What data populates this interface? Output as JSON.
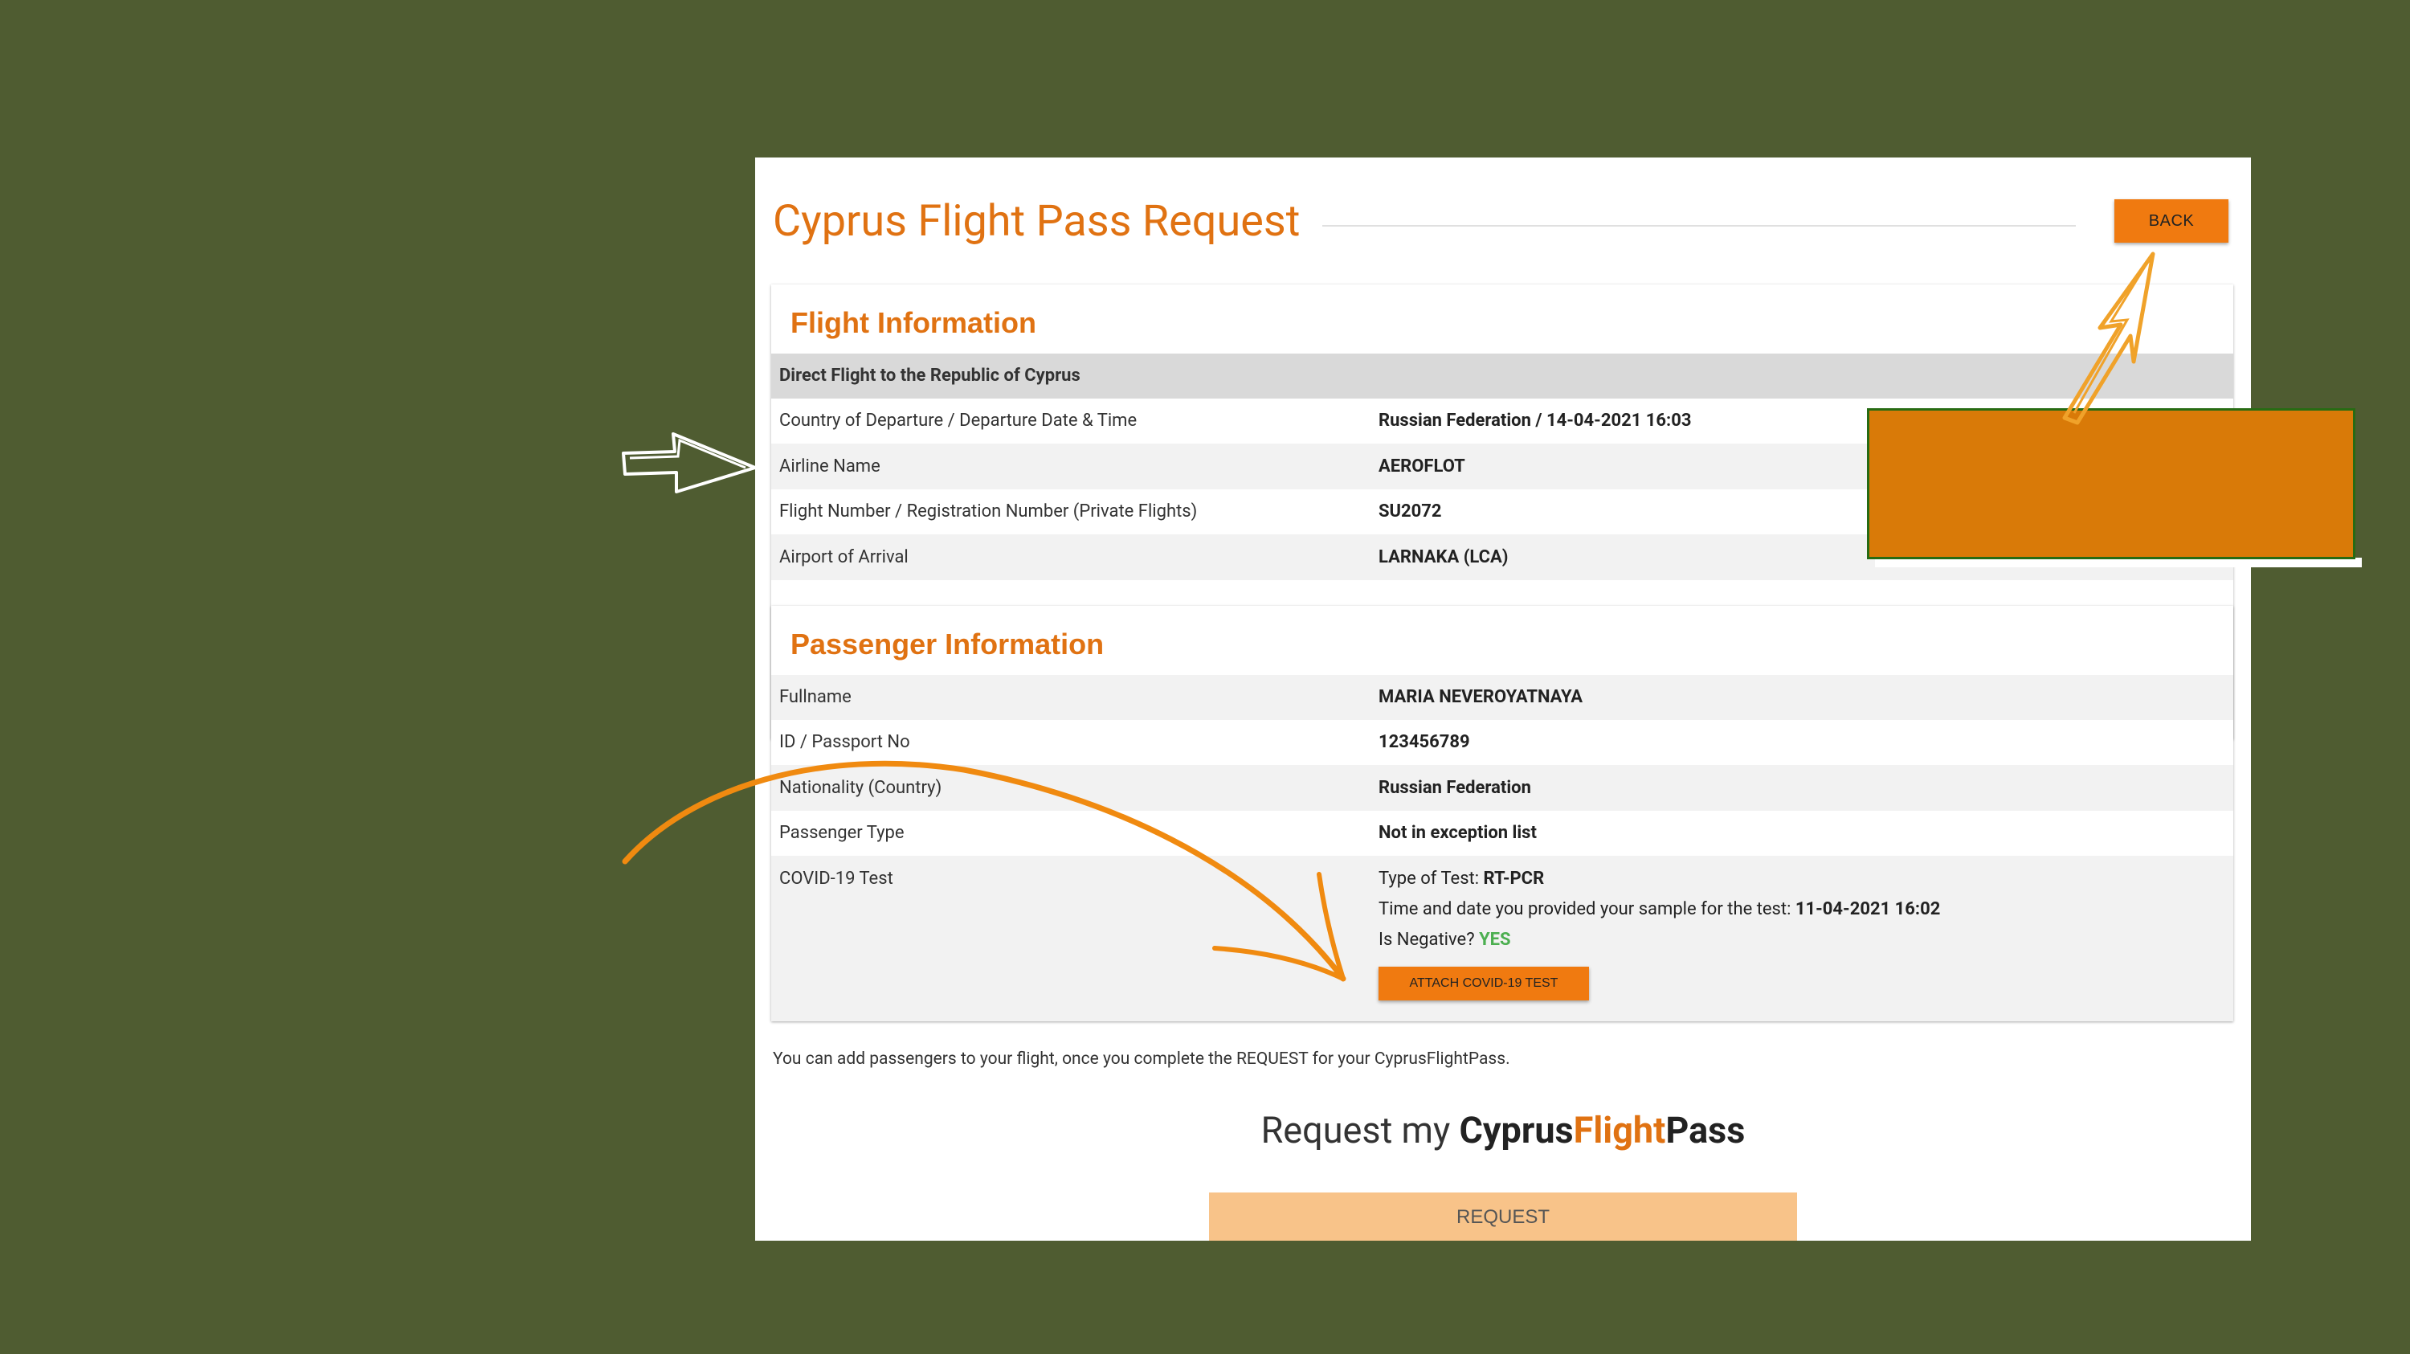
{
  "page": {
    "title": "Cyprus Flight Pass Request",
    "back_label": "BACK"
  },
  "flight": {
    "heading": "Flight Information",
    "section_header": "Direct Flight to the Republic of Cyprus",
    "rows": [
      {
        "label": "Country of Departure / Departure Date & Time",
        "value": "Russian Federation / 14-04-2021 16:03"
      },
      {
        "label": "Airline Name",
        "value": "AEROFLOT"
      },
      {
        "label": "Flight Number / Registration Number (Private Flights)",
        "value": "SU2072"
      },
      {
        "label": "Airport of Arrival",
        "value": "LARNAKA (LCA)"
      }
    ]
  },
  "passenger": {
    "heading": "Passenger Information",
    "rows": [
      {
        "label": "Fullname",
        "value": "MARIA NEVEROYATNAYA"
      },
      {
        "label": "ID / Passport No",
        "value": "123456789"
      },
      {
        "label": "Nationality (Country)",
        "value": "Russian Federation"
      },
      {
        "label": "Passenger Type",
        "value": "Not in exception list"
      }
    ],
    "covid": {
      "label": "COVID-19 Test",
      "type_prefix": "Type of Test: ",
      "type_value": "RT-PCR",
      "time_prefix": "Time and date you provided your sample for the test: ",
      "time_value": "11-04-2021 16:02",
      "negative_prefix": "Is Negative? ",
      "negative_value": "YES",
      "attach_label": "ATTACH COVID-19 TEST"
    }
  },
  "footer": {
    "note": "You can add passengers to your flight, once you complete the REQUEST for your CyprusFlightPass.",
    "request_prefix": "Request my ",
    "brand_part1": "Cyprus",
    "brand_part2": "Flight",
    "brand_part3": "Pass",
    "request_label": "REQUEST"
  },
  "colors": {
    "background": "#4f5c31",
    "accent": "#e07212",
    "button": "#f07a10",
    "request_button": "#f8c389",
    "overlay": "#d97a08",
    "success": "#4caf50"
  }
}
